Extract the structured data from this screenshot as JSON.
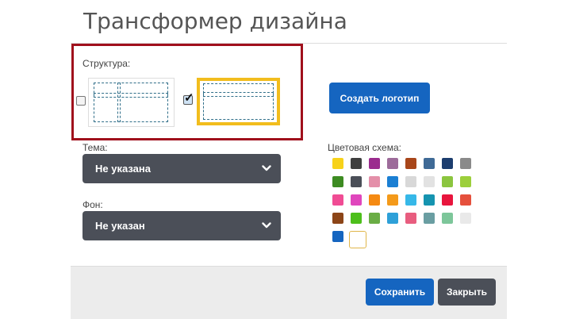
{
  "dialog": {
    "title": "Трансформер дизайна"
  },
  "structure": {
    "label": "Структура:",
    "options": [
      {
        "name": "layout-grid",
        "checked": false
      },
      {
        "name": "layout-rows",
        "checked": true
      }
    ]
  },
  "create_logo_button": "Создать логотип",
  "theme": {
    "label": "Тема:",
    "value": "Не указана"
  },
  "background": {
    "label": "Фон:",
    "value": "Не указан"
  },
  "color_scheme": {
    "label": "Цветовая схема:",
    "colors": [
      "#f7d21a",
      "#3f3f3f",
      "#9b2b8e",
      "#9d6b9a",
      "#a8461a",
      "#3f6a96",
      "#1c3d6e",
      "#8a8a8a",
      "#3d8b22",
      "#4b4f58",
      "#e48fa9",
      "#1b7fd3",
      "#d8d8d8",
      "#e2e2e2",
      "#8bc53f",
      "#9ccf3b",
      "#f04c94",
      "#e046bd",
      "#f58a12",
      "#f49a1a",
      "#36b8e8",
      "#1594b0",
      "#e8153d",
      "#e5503c",
      "#8c4518",
      "#4dbf1b",
      "#6aad45",
      "#2ea0d8",
      "#e85d7f",
      "#6a9ea2",
      "#7dc69a",
      "#e9e9e9",
      "#1565c0"
    ],
    "selected_index": 32
  },
  "footer": {
    "save": "Сохранить",
    "close": "Закрыть"
  }
}
